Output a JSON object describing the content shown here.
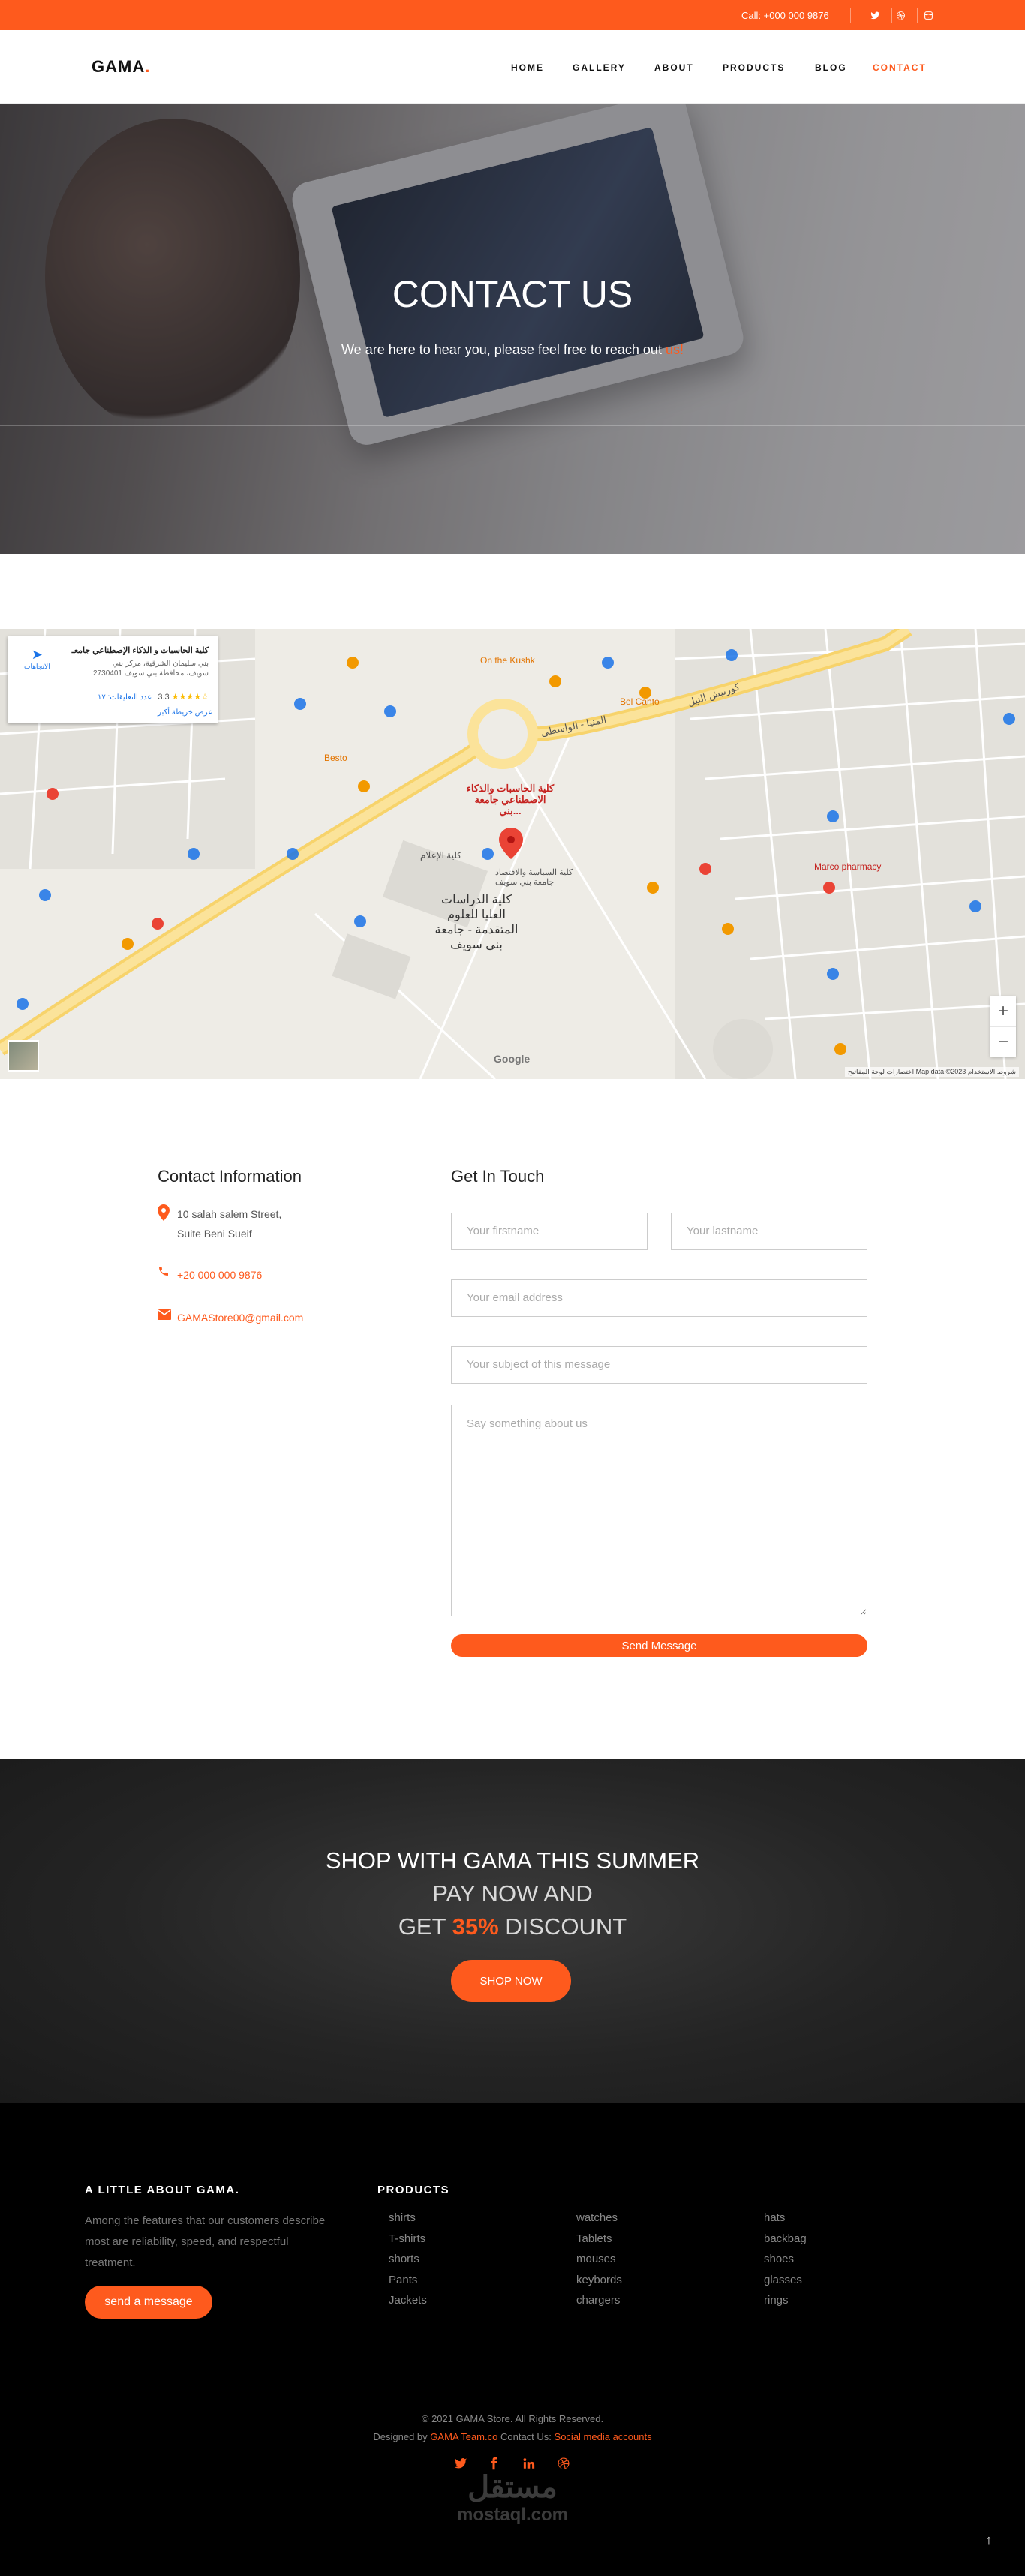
{
  "topbar": {
    "phone": "Call: +000 000 9876",
    "social_icons": [
      "twitter-icon",
      "dribbble-icon",
      "instagram-icon"
    ]
  },
  "brand": {
    "name": "GAMA",
    "dot": ".",
    "accent_color": "#fe5a1d"
  },
  "nav": {
    "items": [
      "HOME",
      "GALLERY",
      "ABOUT",
      "PRODUCTS",
      "BLOG",
      "CONTACT"
    ],
    "active": "CONTACT"
  },
  "hero": {
    "title": "CONTACT US",
    "subtitle": "We are here to hear you, please feel free to reach out",
    "subtitle_accent": "us!"
  },
  "map": {
    "place_title": "كلية الحاسبات و الذكاء الإصطناعي جامعـ",
    "place_address": "بني سليمان الشرقية، مركز بني سويف، محافظة بني سويف 2730401",
    "rating": "3.3",
    "stars": "★★★★☆",
    "reviews": "عدد التعليقات: ١٧",
    "larger_map": "عرض خريطة أكبر",
    "directions": "الاتجاهات",
    "pin_label": "كلية الحاسبات والذكاء الاصطناعي جامعة بني...",
    "labels": {
      "institute": "كلية الدراسات العليا للعلوم المتقدمة - جامعة بنى سويف",
      "media": "كلية الإعلام",
      "politics": "كلية السياسة والاقتصاد جامعة بني سويف",
      "road": "المنيا - الواسطى",
      "corniche": "كورنيش النيل",
      "pharmacy": "Marco pharmacy",
      "kushk": "On the Kushk",
      "belcanto": "Bel Canto",
      "besto": "Besto"
    },
    "google": "Google",
    "attribution": "اختصارات لوحة المفاتيح   Map data ©2023   شروط الاستخدام",
    "zoom_in": "+",
    "zoom_out": "−"
  },
  "contact_info": {
    "heading": "Contact Information",
    "address_line1": "10 salah salem Street,",
    "address_line2": "Suite Beni Sueif",
    "phone": "+20 000 000 9876",
    "email": "GAMAStore00@gmail.com"
  },
  "form": {
    "heading": "Get In Touch",
    "firstname_placeholder": "Your firstname",
    "lastname_placeholder": "Your lastname",
    "email_placeholder": "Your email address",
    "subject_placeholder": "Your subject of this message",
    "message_placeholder": "Say something about us",
    "send_label": "Send Message"
  },
  "promo": {
    "line1": "SHOP WITH GAMA THIS SUMMER",
    "line2": "PAY NOW AND",
    "line3_prefix": "GET",
    "line3_percent": "35%",
    "line3_suffix": "DISCOUNT",
    "button": "SHOP NOW"
  },
  "footer": {
    "about_heading": "A LITTLE ABOUT GAMA.",
    "about_text": "Among the features that our customers describe most are reliability, speed, and respectful treatment.",
    "about_button": "send a message",
    "products_heading": "PRODUCTS",
    "products_col1": [
      "shirts",
      "T-shirts",
      "shorts",
      "Pants",
      "Jackets"
    ],
    "products_col2": [
      "watches",
      "Tablets",
      "mouses",
      "keybords",
      "chargers"
    ],
    "products_col3": [
      "hats",
      "backbag",
      "shoes",
      "glasses",
      "rings"
    ],
    "copyright": "© 2021 GAMA Store. All Rights Reserved.",
    "designed_prefix": "Designed by",
    "designed_team": "GAMA Team.co",
    "contact_prefix": "Contact Us:",
    "social_link": "Social media accounts",
    "social_icons": [
      "twitter-icon",
      "facebook-icon",
      "linkedin-icon",
      "dribbble-icon"
    ],
    "watermark_arabic": "مستقل",
    "watermark_latin": "mostaql.com",
    "to_top": "↑"
  }
}
